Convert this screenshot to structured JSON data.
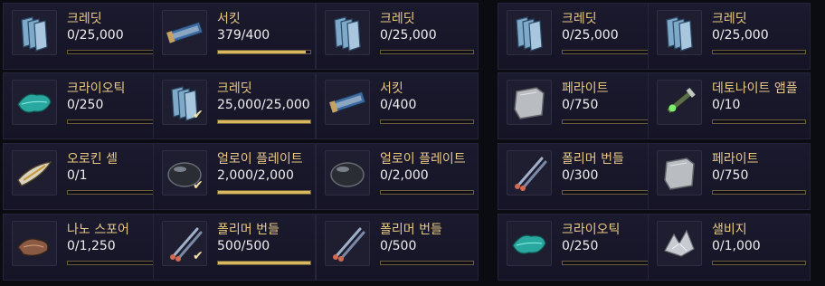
{
  "colors": {
    "name_text": "#e8c883",
    "count_text": "#eeeeee",
    "bar_fill": "#d9b860",
    "bar_border": "#6a5d3a",
    "cell_background": "#1b1a2e"
  },
  "rows": [
    [
      {
        "name": "크레딧",
        "count": "0/25,000",
        "icon": "credit-icon",
        "progress": 0,
        "checked": false
      },
      {
        "name": "서킷",
        "count": "379/400",
        "icon": "circuit-board-icon",
        "progress": 0.9475,
        "checked": false
      },
      {
        "name": "크레딧",
        "count": "0/25,000",
        "icon": "credit-icon",
        "progress": 0,
        "checked": false
      },
      {
        "name": "크레딧",
        "count": "0/25,000",
        "icon": "credit-icon",
        "progress": 0,
        "checked": false
      },
      {
        "name": "크레딧",
        "count": "0/25,000",
        "icon": "credit-icon",
        "progress": 0,
        "checked": false
      }
    ],
    [
      {
        "name": "크라이오틱",
        "count": "0/250",
        "icon": "cryotic-leaf-icon",
        "progress": 0,
        "checked": false
      },
      {
        "name": "크레딧",
        "count": "25,000/25,000",
        "icon": "credit-icon",
        "progress": 1,
        "checked": true
      },
      {
        "name": "서킷",
        "count": "0/400",
        "icon": "circuit-board-icon",
        "progress": 0,
        "checked": false
      },
      {
        "name": "페라이트",
        "count": "0/750",
        "icon": "ferrite-block-icon",
        "progress": 0,
        "checked": false
      },
      {
        "name": "데토나이트 앰플",
        "count": "0/10",
        "icon": "detonite-ampule-icon",
        "progress": 0,
        "checked": false
      }
    ],
    [
      {
        "name": "오로킨 셀",
        "count": "0/1",
        "icon": "orokin-cell-icon",
        "progress": 0,
        "checked": false
      },
      {
        "name": "얼로이 플레이트",
        "count": "2,000/2,000",
        "icon": "alloy-plate-icon",
        "progress": 1,
        "checked": true
      },
      {
        "name": "얼로이 플레이트",
        "count": "0/2,000",
        "icon": "alloy-plate-icon",
        "progress": 0,
        "checked": false
      },
      {
        "name": "폴리머 번들",
        "count": "0/300",
        "icon": "polymer-bundle-icon",
        "progress": 0,
        "checked": false
      },
      {
        "name": "페라이트",
        "count": "0/750",
        "icon": "ferrite-block-icon",
        "progress": 0,
        "checked": false
      }
    ],
    [
      {
        "name": "나노 스포어",
        "count": "0/1,250",
        "icon": "nano-spores-icon",
        "progress": 0,
        "checked": false
      },
      {
        "name": "폴리머 번들",
        "count": "500/500",
        "icon": "polymer-bundle-icon",
        "progress": 1,
        "checked": true
      },
      {
        "name": "폴리머 번들",
        "count": "0/500",
        "icon": "polymer-bundle-icon",
        "progress": 0,
        "checked": false
      },
      {
        "name": "크라이오틱",
        "count": "0/250",
        "icon": "cryotic-leaf-icon",
        "progress": 0,
        "checked": false
      },
      {
        "name": "샐비지",
        "count": "0/1,000",
        "icon": "salvage-icon",
        "progress": 0,
        "checked": false
      }
    ]
  ]
}
